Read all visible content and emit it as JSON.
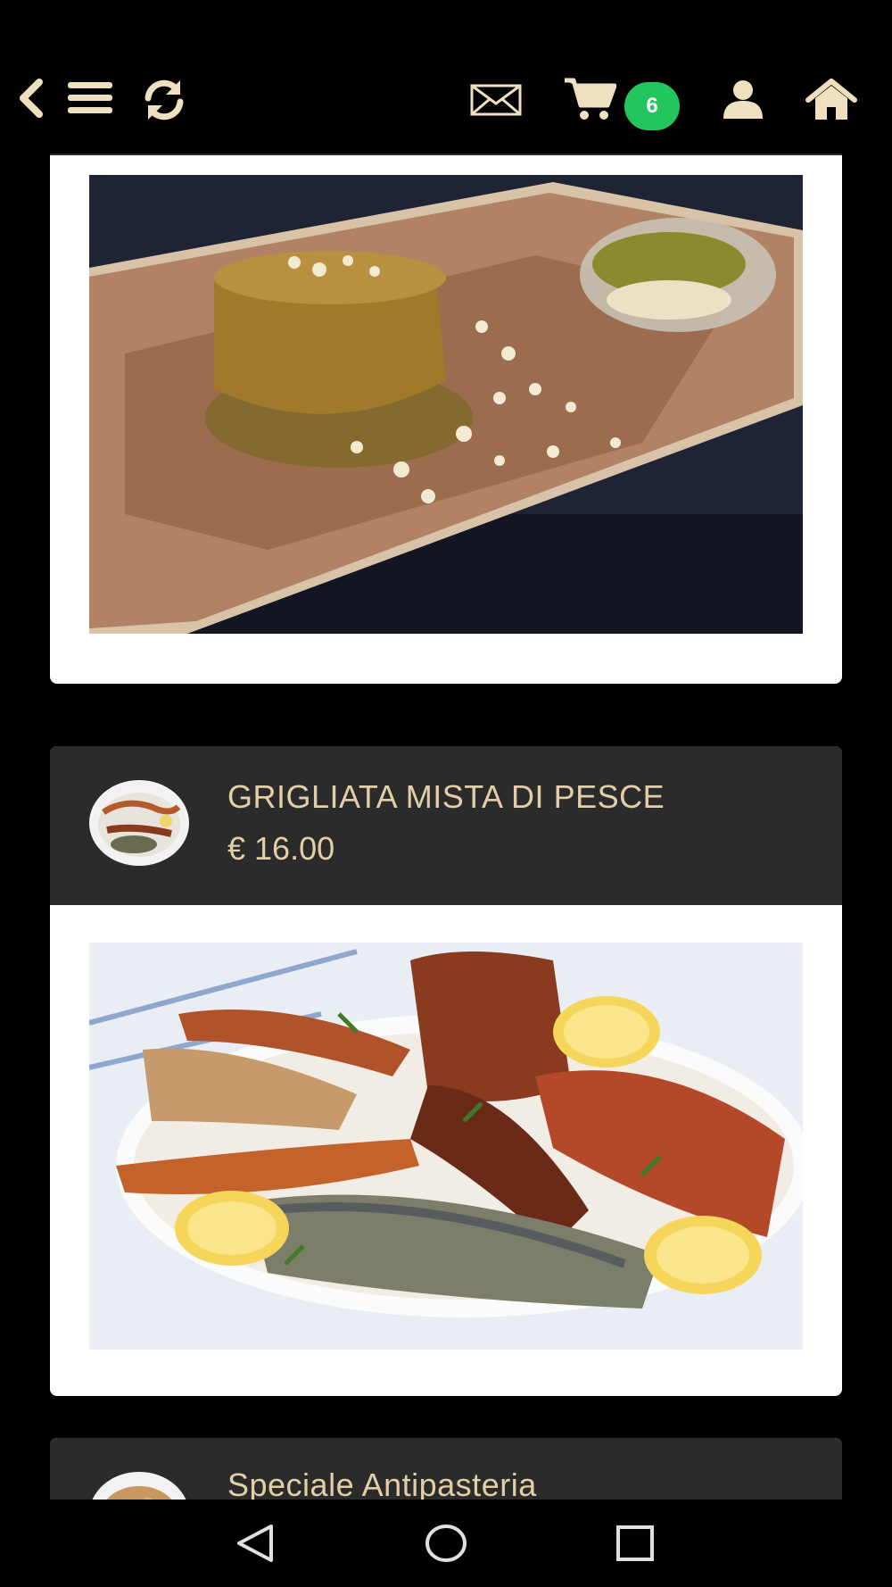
{
  "topbar": {
    "icons": [
      "chevron-left-icon",
      "menu-icon",
      "refresh-icon",
      "envelope-icon",
      "cart-icon",
      "user-icon",
      "home-icon"
    ],
    "cart_count": "6",
    "accent_color": "#efe0c0",
    "badge_color": "#22c55e"
  },
  "menu": {
    "items": [
      {
        "name": "GRIGLIATA MISTA DI PESCE",
        "price": "€ 16.00"
      },
      {
        "name": "Speciale Antipasteria",
        "price": ""
      }
    ]
  },
  "colors": {
    "header_bg": "#2b2b2b",
    "text_gold": "#e2cfa8"
  },
  "navbar": {
    "icons": [
      "back-triangle-icon",
      "home-circle-icon",
      "recents-square-icon"
    ]
  }
}
